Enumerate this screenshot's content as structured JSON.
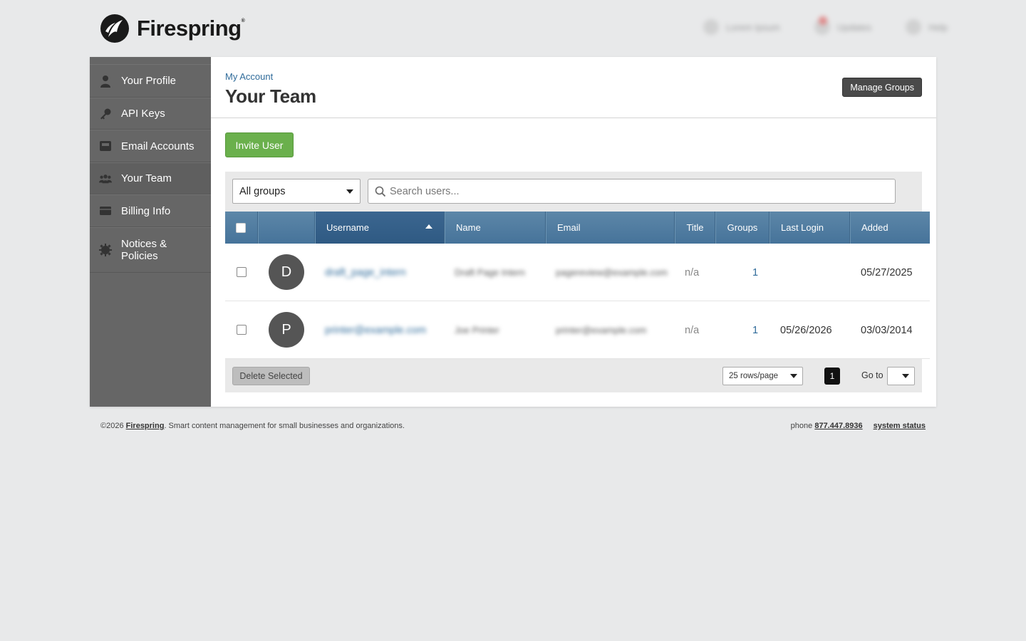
{
  "brand": {
    "name": "Firespring"
  },
  "top_nav": [
    {
      "label": "Lorem Ipsum",
      "icon": "user-icon"
    },
    {
      "label": "Updates",
      "icon": "bell-icon"
    },
    {
      "label": "Help",
      "icon": "help-icon"
    }
  ],
  "sidebar": {
    "items": [
      {
        "label": "Your Profile",
        "icon": "person-icon"
      },
      {
        "label": "API Keys",
        "icon": "key-icon"
      },
      {
        "label": "Email Accounts",
        "icon": "inbox-icon"
      },
      {
        "label": "Your Team",
        "icon": "team-icon"
      },
      {
        "label": "Billing Info",
        "icon": "card-icon"
      },
      {
        "label": "Notices & Policies",
        "icon": "gear-icon"
      }
    ]
  },
  "header": {
    "breadcrumb": "My Account",
    "title": "Your Team",
    "manage_groups": "Manage Groups"
  },
  "actions": {
    "invite_user": "Invite User"
  },
  "filters": {
    "group_selected": "All groups",
    "search_placeholder": "Search users..."
  },
  "table": {
    "columns": [
      "Username",
      "Name",
      "Email",
      "Title",
      "Groups",
      "Last Login",
      "Added"
    ],
    "sorted_column": "Username",
    "rows": [
      {
        "initial": "D",
        "username": "draft_page_intern",
        "name": "Draft Page Intern",
        "email": "pagereview@example.com",
        "title": "n/a",
        "groups": "1",
        "last_login": "",
        "added": "05/27/2025"
      },
      {
        "initial": "P",
        "username": "printer@example.com",
        "name": "Joe Printer",
        "email": "printer@example.com",
        "title": "n/a",
        "groups": "1",
        "last_login": "05/26/2026",
        "added": "03/03/2014"
      }
    ]
  },
  "table_footer": {
    "delete_selected": "Delete Selected",
    "rows_per_page": "25 rows/page",
    "current_page": "1",
    "goto_label": "Go to"
  },
  "footer": {
    "copyright": "©2026",
    "company": "Firespring",
    "tagline": ". Smart content management for small businesses and organizations.",
    "phone_label": "phone",
    "phone": "877.447.8936",
    "status_link": "system status"
  },
  "colors": {
    "sidebar_bg": "#666666",
    "table_header": "#4e7ca1",
    "sorted_header": "#35608a",
    "invite_green": "#6ab04c",
    "link_blue": "#2f6b9a"
  }
}
